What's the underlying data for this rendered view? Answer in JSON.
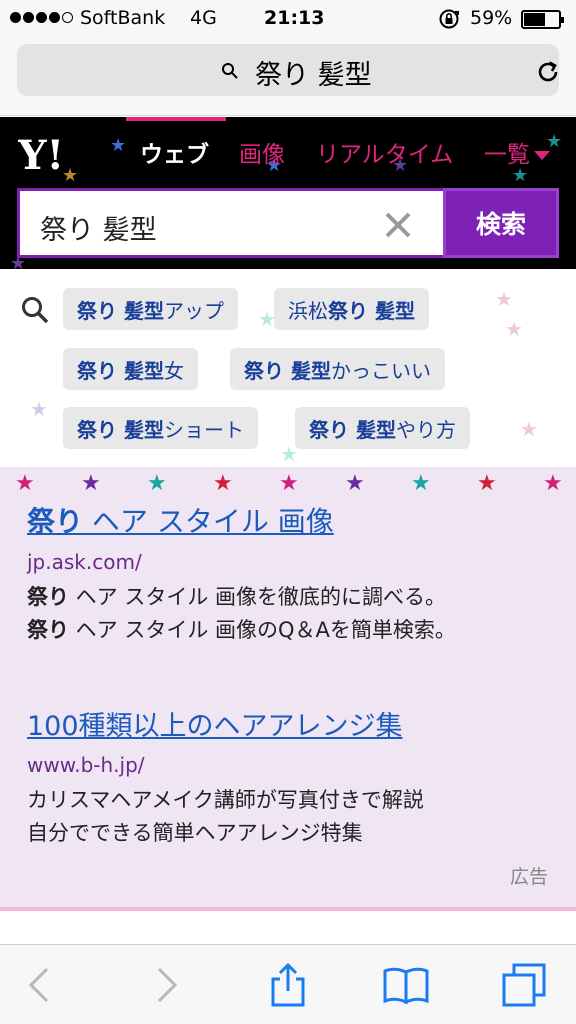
{
  "status": {
    "carrier": "SoftBank",
    "network": "4G",
    "time": "21:13",
    "battery_percent": "59%",
    "battery_level": 0.59
  },
  "address_bar": {
    "query": "祭り 髪型",
    "icons": [
      "search-icon",
      "reload-icon"
    ]
  },
  "header": {
    "logo_text": "Y!",
    "tabs": [
      {
        "label": "ウェブ",
        "active": true
      },
      {
        "label": "画像",
        "active": false
      },
      {
        "label": "リアルタイム",
        "active": false
      },
      {
        "label": "一覧",
        "active": false
      }
    ],
    "search_value": "祭り 髪型",
    "search_button": "検索",
    "colors": {
      "accent": "#e0247e",
      "purple": "#7e22b5"
    }
  },
  "suggestions": [
    {
      "bold": "祭り 髪型",
      "rest": " アップ"
    },
    {
      "pre": "浜松 ",
      "bold": "祭り 髪型",
      "rest": ""
    },
    {
      "bold": "祭り 髪型",
      "rest": " 女"
    },
    {
      "bold": "祭り 髪型",
      "rest": " かっこいい"
    },
    {
      "bold": "祭り 髪型",
      "rest": " ショート"
    },
    {
      "bold": "祭り 髪型",
      "rest": " やり方"
    }
  ],
  "ads": [
    {
      "title_bold": "祭り",
      "title_rest": " ヘア スタイル 画像",
      "url": "jp.ask.com/",
      "lines": [
        {
          "bold": "祭り",
          "rest": " ヘア スタイル 画像を徹底的に調べる。"
        },
        {
          "bold": "祭り",
          "rest": " ヘア スタイル 画像のQ＆Aを簡単検索。"
        }
      ]
    },
    {
      "title_bold": "",
      "title_rest": "100種類以上のヘアアレンジ集",
      "url": "www.b-h.jp/",
      "lines": [
        {
          "bold": "",
          "rest": "カリスマヘアメイク講師が写真付きで解説"
        },
        {
          "bold": "",
          "rest": "自分でできる簡単ヘアアレンジ特集"
        }
      ]
    }
  ],
  "ad_label": "広告",
  "toolbar": {
    "icons": [
      "back-icon",
      "forward-icon",
      "share-icon",
      "bookmarks-icon",
      "tabs-icon"
    ]
  }
}
